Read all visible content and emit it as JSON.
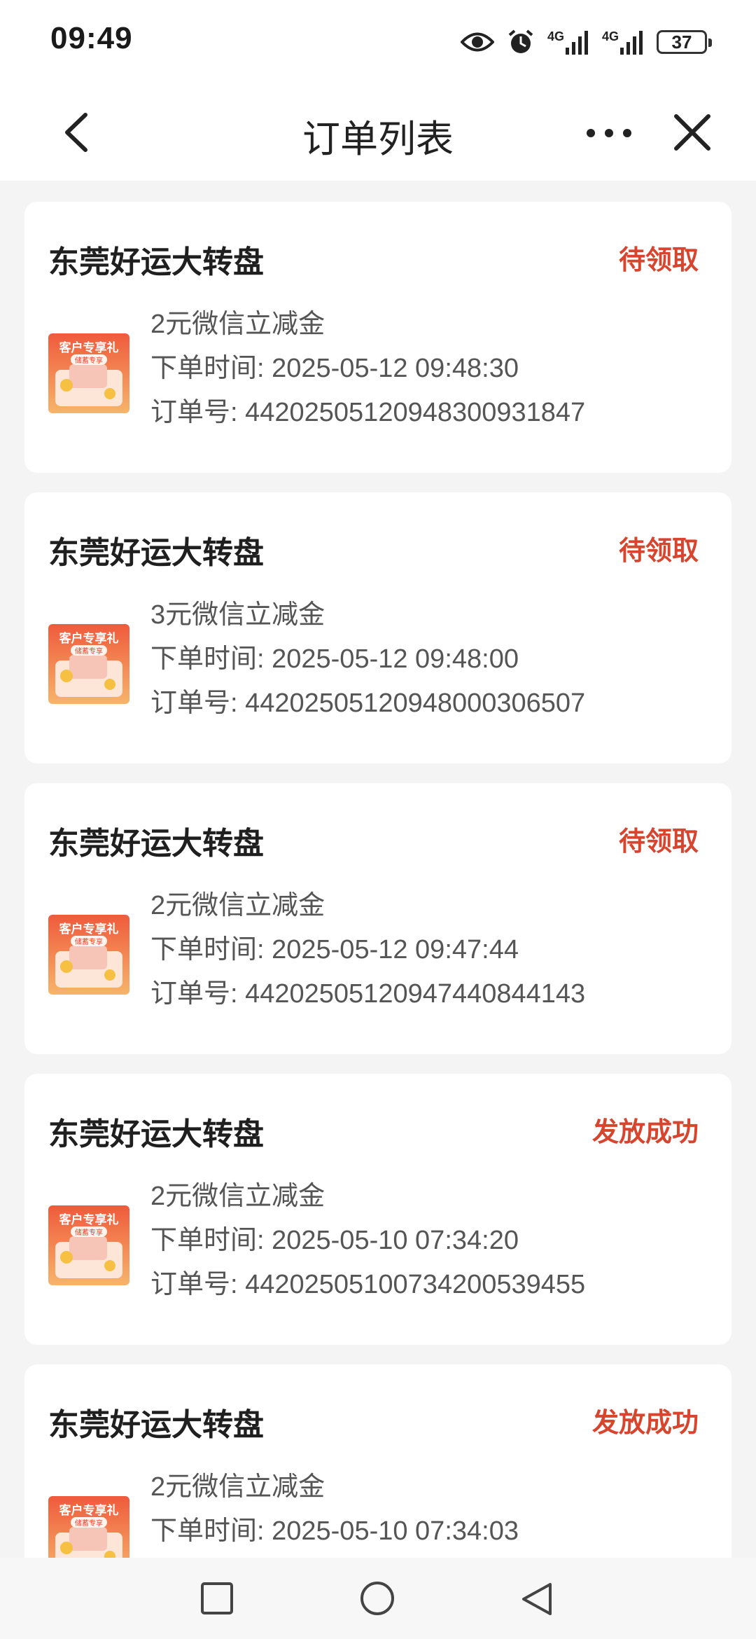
{
  "status_bar": {
    "time": "09:49",
    "battery": "37",
    "signal_1": "4G",
    "signal_2": "4G",
    "icons": [
      "eye-icon",
      "alarm-icon",
      "signal-4g-icon",
      "signal-4g-icon",
      "battery-icon"
    ]
  },
  "nav": {
    "title": "订单列表",
    "back_icon": "chevron-left-icon",
    "more_icon": "more-dots-icon",
    "close_icon": "close-icon"
  },
  "orders": [
    {
      "title": "东莞好运大转盘",
      "status": "待领取",
      "product": "2元微信立减金",
      "time": "下单时间: 2025-05-12 09:48:30",
      "order_no": "订单号: 44202505120948300931847"
    },
    {
      "title": "东莞好运大转盘",
      "status": "待领取",
      "product": "3元微信立减金",
      "time": "下单时间: 2025-05-12 09:48:00",
      "order_no": "订单号: 44202505120948000306507"
    },
    {
      "title": "东莞好运大转盘",
      "status": "待领取",
      "product": "2元微信立减金",
      "time": "下单时间: 2025-05-12 09:47:44",
      "order_no": "订单号: 44202505120947440844143"
    },
    {
      "title": "东莞好运大转盘",
      "status": "发放成功",
      "product": "2元微信立减金",
      "time": "下单时间: 2025-05-10 07:34:20",
      "order_no": "订单号: 44202505100734200539455"
    },
    {
      "title": "东莞好运大转盘",
      "status": "发放成功",
      "product": "2元微信立减金",
      "time": "下单时间: 2025-05-10 07:34:03",
      "order_no": ""
    }
  ],
  "thumbnail": {
    "label": "客户专享礼",
    "sub_label": "储蓄专享"
  },
  "system_nav": {
    "recents_icon": "square-icon",
    "home_icon": "circle-icon",
    "back_icon": "triangle-back-icon"
  },
  "colors": {
    "status_red": "#d8452f",
    "thumb_red": "#e8452e",
    "background": "#f4f4f4"
  }
}
